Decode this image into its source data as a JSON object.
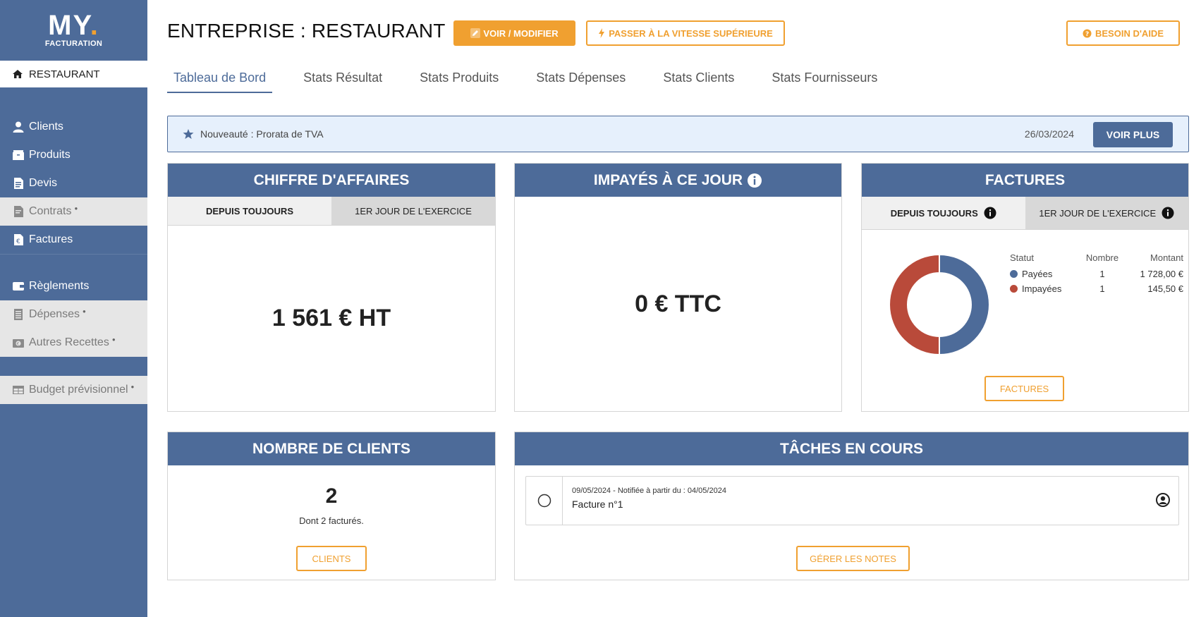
{
  "brand": {
    "logo_main": "MY",
    "logo_dot": ".",
    "logo_sub": "FACTURATION",
    "accent_color": "#f0a030",
    "primary_color": "#4d6b99"
  },
  "sidebar": {
    "company": "RESTAURANT",
    "items": [
      {
        "label": "Clients",
        "icon": "user-icon",
        "locked": false
      },
      {
        "label": "Produits",
        "icon": "box-icon",
        "locked": false
      },
      {
        "label": "Devis",
        "icon": "document-icon",
        "locked": false
      },
      {
        "label": "Contrats",
        "icon": "contract-icon",
        "locked": true
      },
      {
        "label": "Factures",
        "icon": "invoice-icon",
        "locked": false
      },
      {
        "label": "Règlements",
        "icon": "wallet-icon",
        "locked": false
      },
      {
        "label": "Dépenses",
        "icon": "receipt-icon",
        "locked": true
      },
      {
        "label": "Autres Recettes",
        "icon": "money-icon",
        "locked": true
      },
      {
        "label": "Budget prévisionnel",
        "icon": "table-icon",
        "locked": true
      }
    ]
  },
  "header": {
    "title": "ENTREPRISE : RESTAURANT",
    "edit_button": "VOIR / MODIFIER",
    "speed_button": "PASSER À LA VITESSE SUPÉRIEURE",
    "help_button": "BESOIN D'AIDE"
  },
  "tabs": [
    {
      "label": "Tableau de Bord",
      "active": true
    },
    {
      "label": "Stats Résultat",
      "active": false
    },
    {
      "label": "Stats Produits",
      "active": false
    },
    {
      "label": "Stats Dépenses",
      "active": false
    },
    {
      "label": "Stats Clients",
      "active": false
    },
    {
      "label": "Stats Fournisseurs",
      "active": false
    }
  ],
  "news": {
    "text": "Nouveauté : Prorata de TVA",
    "date": "26/03/2024",
    "button": "VOIR PLUS"
  },
  "revenue": {
    "title": "CHIFFRE D'AFFAIRES",
    "tab_all": "DEPUIS TOUJOURS",
    "tab_year": "1ER JOUR DE L'EXERCICE",
    "value": "1 561 € HT"
  },
  "unpaid": {
    "title": "IMPAYÉS À CE JOUR",
    "value": "0 € TTC"
  },
  "invoices": {
    "title": "FACTURES",
    "tab_all": "DEPUIS TOUJOURS",
    "tab_year": "1ER JOUR DE L'EXERCICE",
    "col_status": "Statut",
    "col_count": "Nombre",
    "col_amount": "Montant",
    "rows": [
      {
        "status": "Payées",
        "count": "1",
        "amount": "1 728,00 €",
        "color": "#4d6b99"
      },
      {
        "status": "Impayées",
        "count": "1",
        "amount": "145,50 €",
        "color": "#b94a3a"
      }
    ],
    "button": "FACTURES"
  },
  "chart_data": {
    "type": "pie",
    "categories": [
      "Payées",
      "Impayées"
    ],
    "values": [
      1,
      1
    ],
    "colors": [
      "#4d6b99",
      "#b94a3a"
    ],
    "donut": true
  },
  "clients": {
    "title": "NOMBRE DE CLIENTS",
    "count": "2",
    "subtitle": "Dont 2 facturés.",
    "button": "CLIENTS"
  },
  "tasks": {
    "title": "TÂCHES EN COURS",
    "items": [
      {
        "meta": "09/05/2024 - Notifiée à partir du : 04/05/2024",
        "title": "Facture n°1"
      }
    ],
    "button": "GÉRER LES NOTES"
  }
}
